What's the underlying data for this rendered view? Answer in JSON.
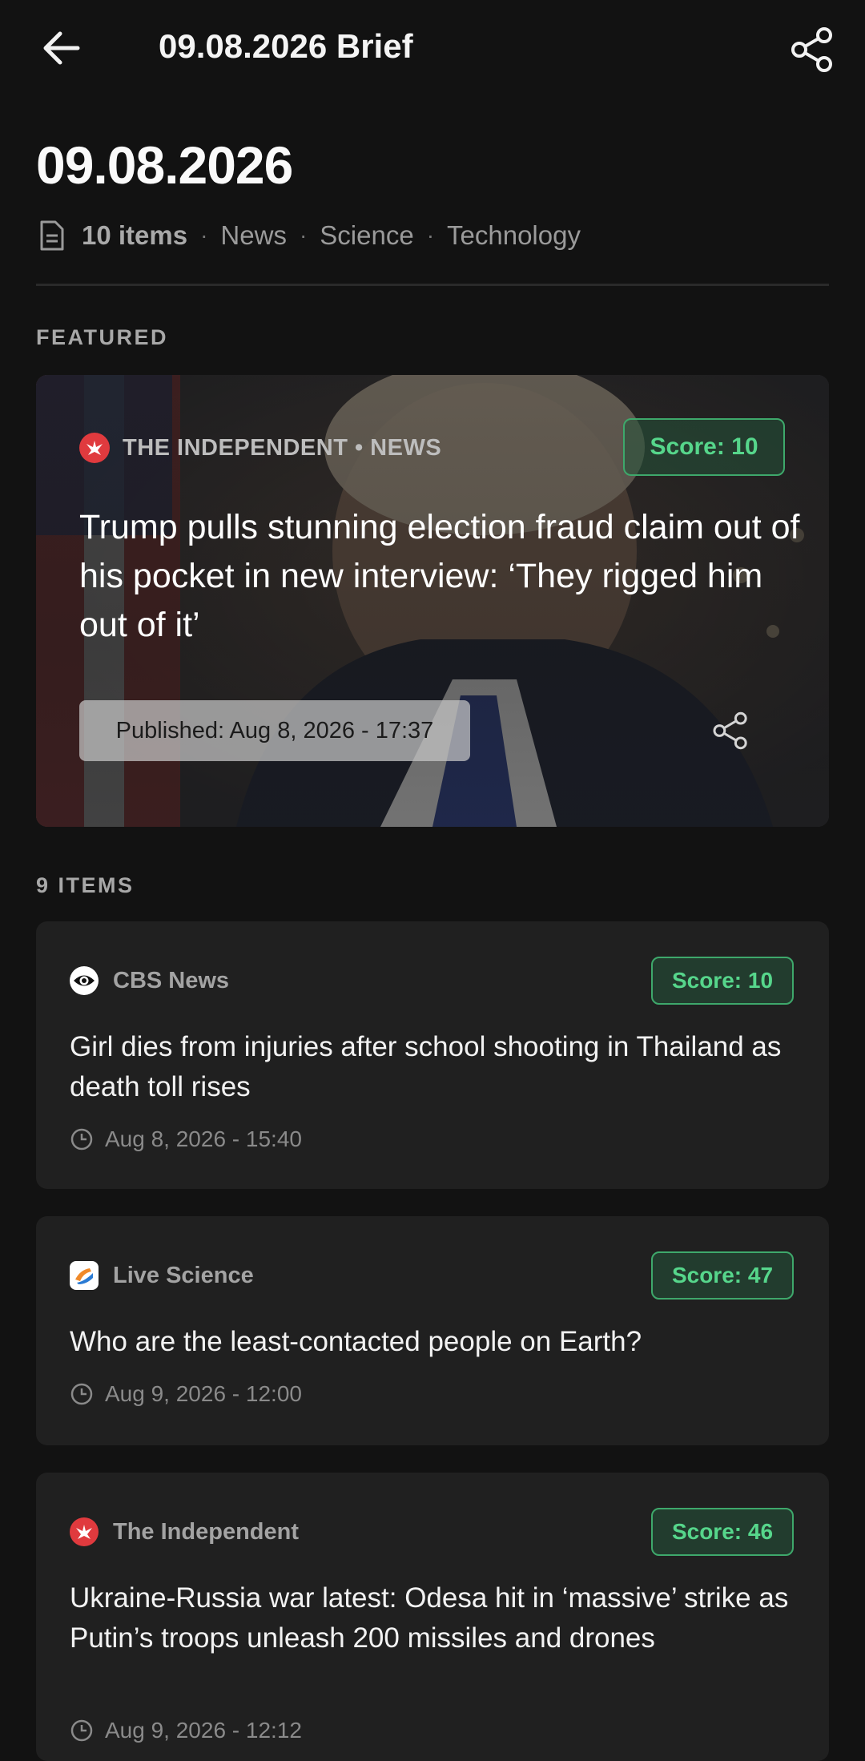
{
  "appbar": {
    "title": "09.08.2026 Brief"
  },
  "header": {
    "date": "09.08.2026",
    "item_count": "10 items",
    "categories": [
      "News",
      "Science",
      "Technology"
    ]
  },
  "featured": {
    "section_label": "FEATURED",
    "source": "THE INDEPENDENT • NEWS",
    "score": "Score: 10",
    "title": "Trump pulls stunning election fraud claim out of his pocket in new interview: ‘They rigged him out of it’",
    "published": "Published: Aug 8, 2026 - 17:37"
  },
  "items": {
    "section_label": "9 ITEMS",
    "list": [
      {
        "source": "CBS News",
        "score": "Score: 10",
        "title": "Girl dies from injuries after school shooting in Thailand as death toll rises",
        "time": "Aug 8, 2026 - 15:40"
      },
      {
        "source": "Live Science",
        "score": "Score: 47",
        "title": "Who are the least-contacted people on Earth?",
        "time": "Aug 9, 2026 - 12:00"
      },
      {
        "source": "The Independent",
        "score": "Score: 46",
        "title": "Ukraine-Russia war latest: Odesa hit in ‘massive’ strike as Putin’s troops unleash 200 missiles and drones",
        "time": "Aug 9, 2026 - 12:12"
      }
    ]
  },
  "colors": {
    "background": "#121212",
    "card": "#202020",
    "score_accent": "#56d68b",
    "independent_red": "#e03a3e"
  }
}
